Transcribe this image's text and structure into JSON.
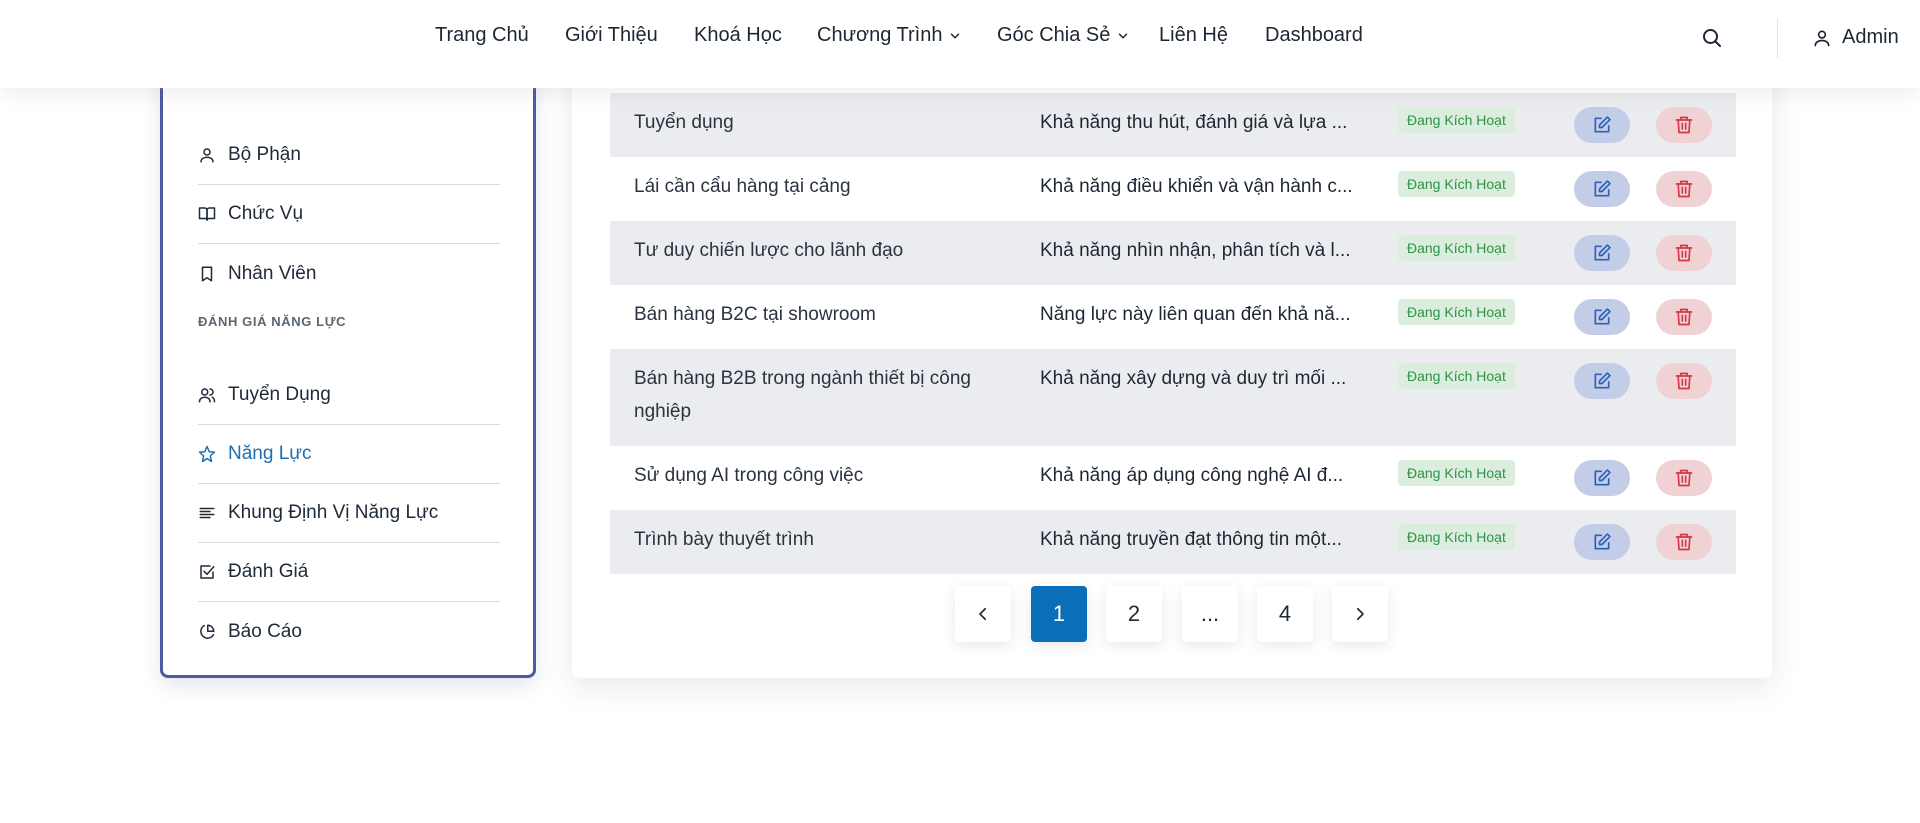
{
  "nav": {
    "items": [
      {
        "label": "Trang Chủ",
        "has_dropdown": false
      },
      {
        "label": "Giới Thiệu",
        "has_dropdown": false
      },
      {
        "label": "Khoá Học",
        "has_dropdown": false
      },
      {
        "label": "Chương Trình",
        "has_dropdown": true
      },
      {
        "label": "Góc Chia Sẻ",
        "has_dropdown": true
      },
      {
        "label": "Liên Hệ",
        "has_dropdown": false
      },
      {
        "label": "Dashboard",
        "has_dropdown": false
      }
    ],
    "user_label": "Admin",
    "search_icon": "search-icon",
    "user_icon": "user-icon"
  },
  "sidebar": {
    "items_top": [
      {
        "label": "Bộ Phận",
        "icon": "user-icon"
      },
      {
        "label": "Chức Vụ",
        "icon": "book-icon"
      },
      {
        "label": "Nhân Viên",
        "icon": "bookmark-icon"
      }
    ],
    "section_title": "ĐÁNH GIÁ NĂNG LỰC",
    "items_bottom": [
      {
        "label": "Tuyển Dụng",
        "icon": "users-icon",
        "active": false
      },
      {
        "label": "Năng Lực",
        "icon": "star-icon",
        "active": true
      },
      {
        "label": "Khung Định Vị Năng Lực",
        "icon": "align-left-icon",
        "active": false
      },
      {
        "label": "Đánh Giá",
        "icon": "check-square-icon",
        "active": false
      },
      {
        "label": "Báo Cáo",
        "icon": "pie-chart-icon",
        "active": false
      }
    ],
    "active_color": "#1c6fb0"
  },
  "table": {
    "rows": [
      {
        "name": "Tuyển dụng",
        "description": "Khả năng thu hút, đánh giá và lựa ...",
        "status": "Đang Kích Hoạt"
      },
      {
        "name": "Lái cần cẩu hàng tại cảng",
        "description": "Khả năng điều khiển và vận hành c...",
        "status": "Đang Kích Hoạt"
      },
      {
        "name": "Tư duy chiến lược cho lãnh đạo",
        "description": "Khả năng nhìn nhận, phân tích và l...",
        "status": "Đang Kích Hoạt"
      },
      {
        "name": "Bán hàng B2C tại showroom",
        "description": "Năng lực này liên quan đến khả nă...",
        "status": "Đang Kích Hoạt"
      },
      {
        "name": "Bán hàng B2B trong ngành thiết bị công nghiệp",
        "description": "Khả năng xây dựng và duy trì mối ...",
        "status": "Đang Kích Hoạt"
      },
      {
        "name": "Sử dụng AI trong công việc",
        "description": "Khả năng áp dụng công nghệ AI đ...",
        "status": "Đang Kích Hoạt"
      },
      {
        "name": "Trình bày thuyết trình",
        "description": "Khả năng truyền đạt thông tin một...",
        "status": "Đang Kích Hoạt"
      }
    ],
    "edit_icon": "edit-icon",
    "delete_icon": "trash-icon",
    "status_color": "#2f9149"
  },
  "pagination": {
    "pages": [
      "1",
      "2",
      "...",
      "4"
    ],
    "current": "1",
    "prev_icon": "chevron-left-icon",
    "next_icon": "chevron-right-icon",
    "accent": "#0a6fb8"
  }
}
